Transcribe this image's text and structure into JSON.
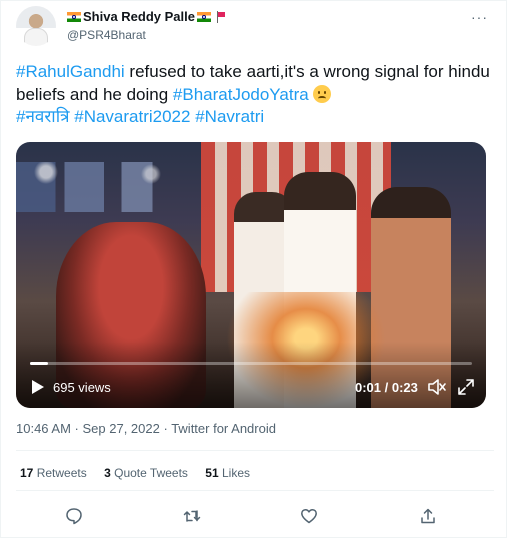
{
  "author": {
    "display_name": "Shiva Reddy Palle",
    "handle": "@PSR4Bharat"
  },
  "more_label": "···",
  "tweet": {
    "hashtag_rahul": "#RahulGandhi",
    "text_1": " refused to take aarti,it's a wrong signal for hindu beliefs and he doing ",
    "hashtag_bharat": "#BharatJodoYatra",
    "hashtag_navratri_hindi": "#नवरात्रि",
    "hashtag_navaratri2022": "#Navaratri2022",
    "hashtag_navratri": "#Navratri"
  },
  "video": {
    "views": "695 views",
    "time": "0:01 / 0:23",
    "progress_fraction": 0.04
  },
  "meta": {
    "time": "10:46 AM",
    "separator": " · ",
    "date": "Sep 27, 2022",
    "source": "Twitter for Android"
  },
  "stats": {
    "retweets_count": "17",
    "retweets_label": "Retweets",
    "quotes_count": "3",
    "quotes_label": "Quote Tweets",
    "likes_count": "51",
    "likes_label": "Likes"
  },
  "colors": {
    "link": "#1d9bf0",
    "secondary_text": "#536471",
    "divider": "#eff3f4"
  },
  "icons": [
    "flag-india-icon",
    "red-flag-icon",
    "more-icon",
    "play-icon",
    "mute-icon",
    "expand-icon",
    "reply-icon",
    "retweet-icon",
    "like-icon",
    "share-icon",
    "emoji-icon"
  ]
}
